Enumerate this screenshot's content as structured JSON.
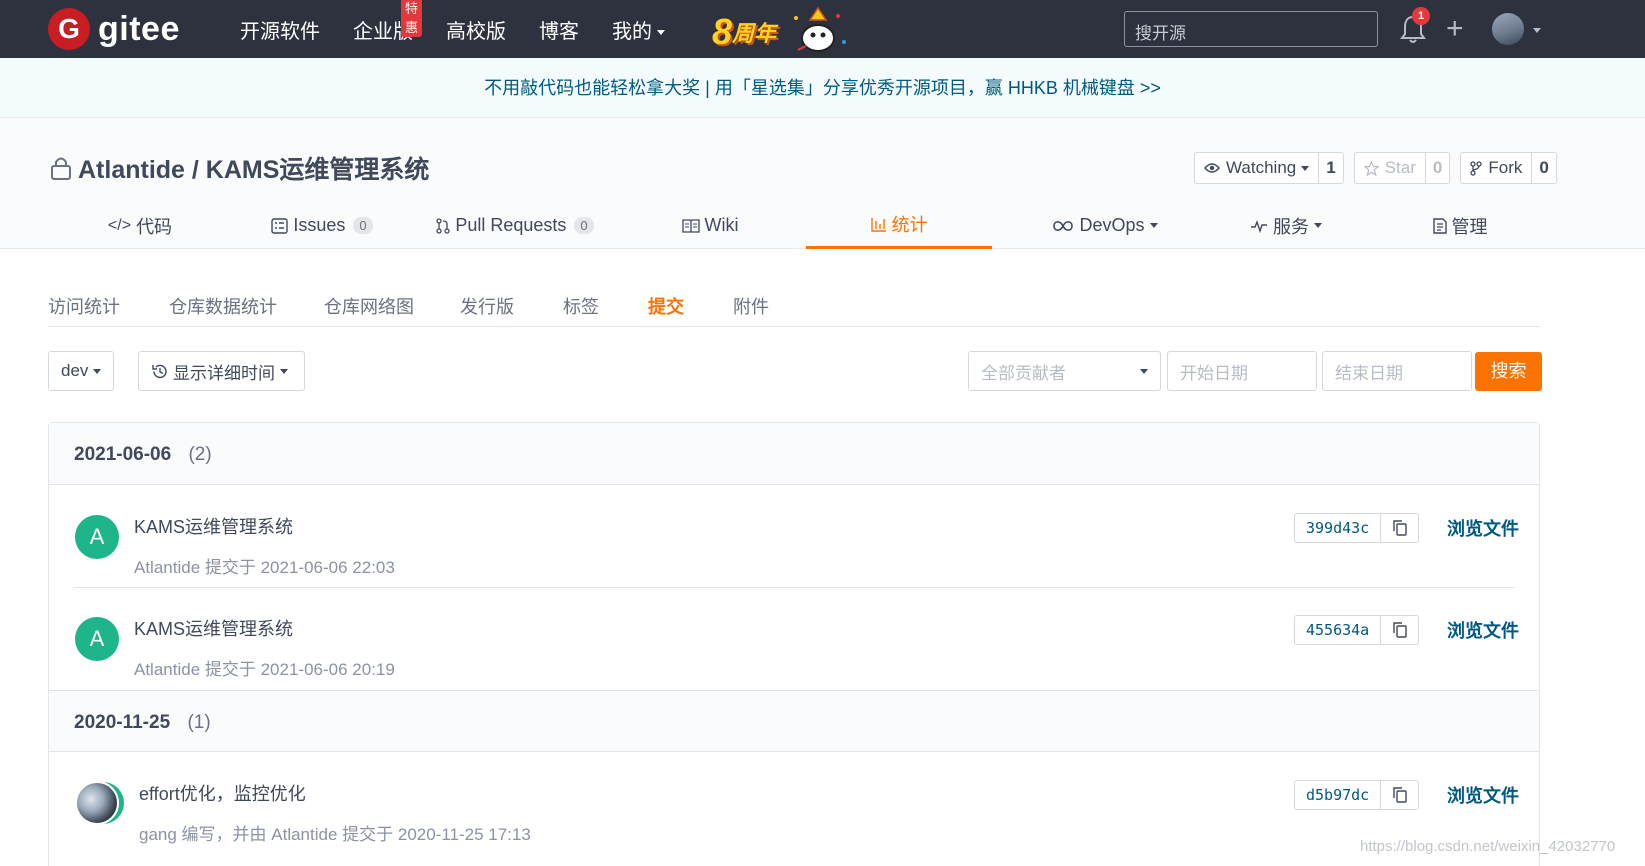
{
  "topbar": {
    "logo_letter": "G",
    "logo_text": "gitee",
    "nav": [
      "开源软件",
      "企业版",
      "高校版",
      "博客",
      "我的"
    ],
    "hot_badge": "特惠",
    "anniversary_num": "8",
    "anniversary_text": "周年",
    "search_placeholder": "搜开源",
    "notification_count": "1",
    "plus": "+"
  },
  "banner": {
    "text": "不用敲代码也能轻松拿大奖 | 用「星选集」分享优秀开源项目，赢 HHKB 机械键盘 >>"
  },
  "repo": {
    "name": "Atlantide / KAMS运维管理系统",
    "watch_label": "Watching",
    "watch_count": "1",
    "star_label": "Star",
    "star_count": "0",
    "fork_label": "Fork",
    "fork_count": "0",
    "tabs": [
      {
        "label": "代码",
        "icon": "</>"
      },
      {
        "label": "Issues",
        "badge": "0"
      },
      {
        "label": "Pull Requests",
        "badge": "0"
      },
      {
        "label": "Wiki"
      },
      {
        "label": "统计"
      },
      {
        "label": "DevOps"
      },
      {
        "label": "服务"
      },
      {
        "label": "管理"
      }
    ]
  },
  "subnav": [
    "访问统计",
    "仓库数据统计",
    "仓库网络图",
    "发行版",
    "标签",
    "提交",
    "附件"
  ],
  "filters": {
    "branch": "dev",
    "detail_time": "显示详细时间",
    "contributors": "全部贡献者",
    "start_date": "开始日期",
    "end_date": "结束日期",
    "search": "搜索"
  },
  "groups": [
    {
      "date": "2021-06-06",
      "count": "(2)"
    },
    {
      "date": "2020-11-25",
      "count": "(1)"
    }
  ],
  "commits": [
    {
      "avatar": "A",
      "message": "KAMS运维管理系统",
      "meta": "Atlantide 提交于 2021-06-06 22:03",
      "sha": "399d43c",
      "browse": "浏览文件"
    },
    {
      "avatar": "A",
      "message": "KAMS运维管理系统",
      "meta": "Atlantide 提交于 2021-06-06 20:19",
      "sha": "455634a",
      "browse": "浏览文件"
    },
    {
      "avatar": "",
      "message": "effort优化，监控优化",
      "meta": "gang 编写，并由 Atlantide 提交于 2020-11-25 17:13",
      "sha": "d5b97dc",
      "browse": "浏览文件"
    }
  ],
  "watermark": "https://blog.csdn.net/weixin_42032770",
  "colors": {
    "accent": "#fe7300",
    "topbar": "#2e323e",
    "link": "#005980",
    "avatar": "#1db589"
  }
}
